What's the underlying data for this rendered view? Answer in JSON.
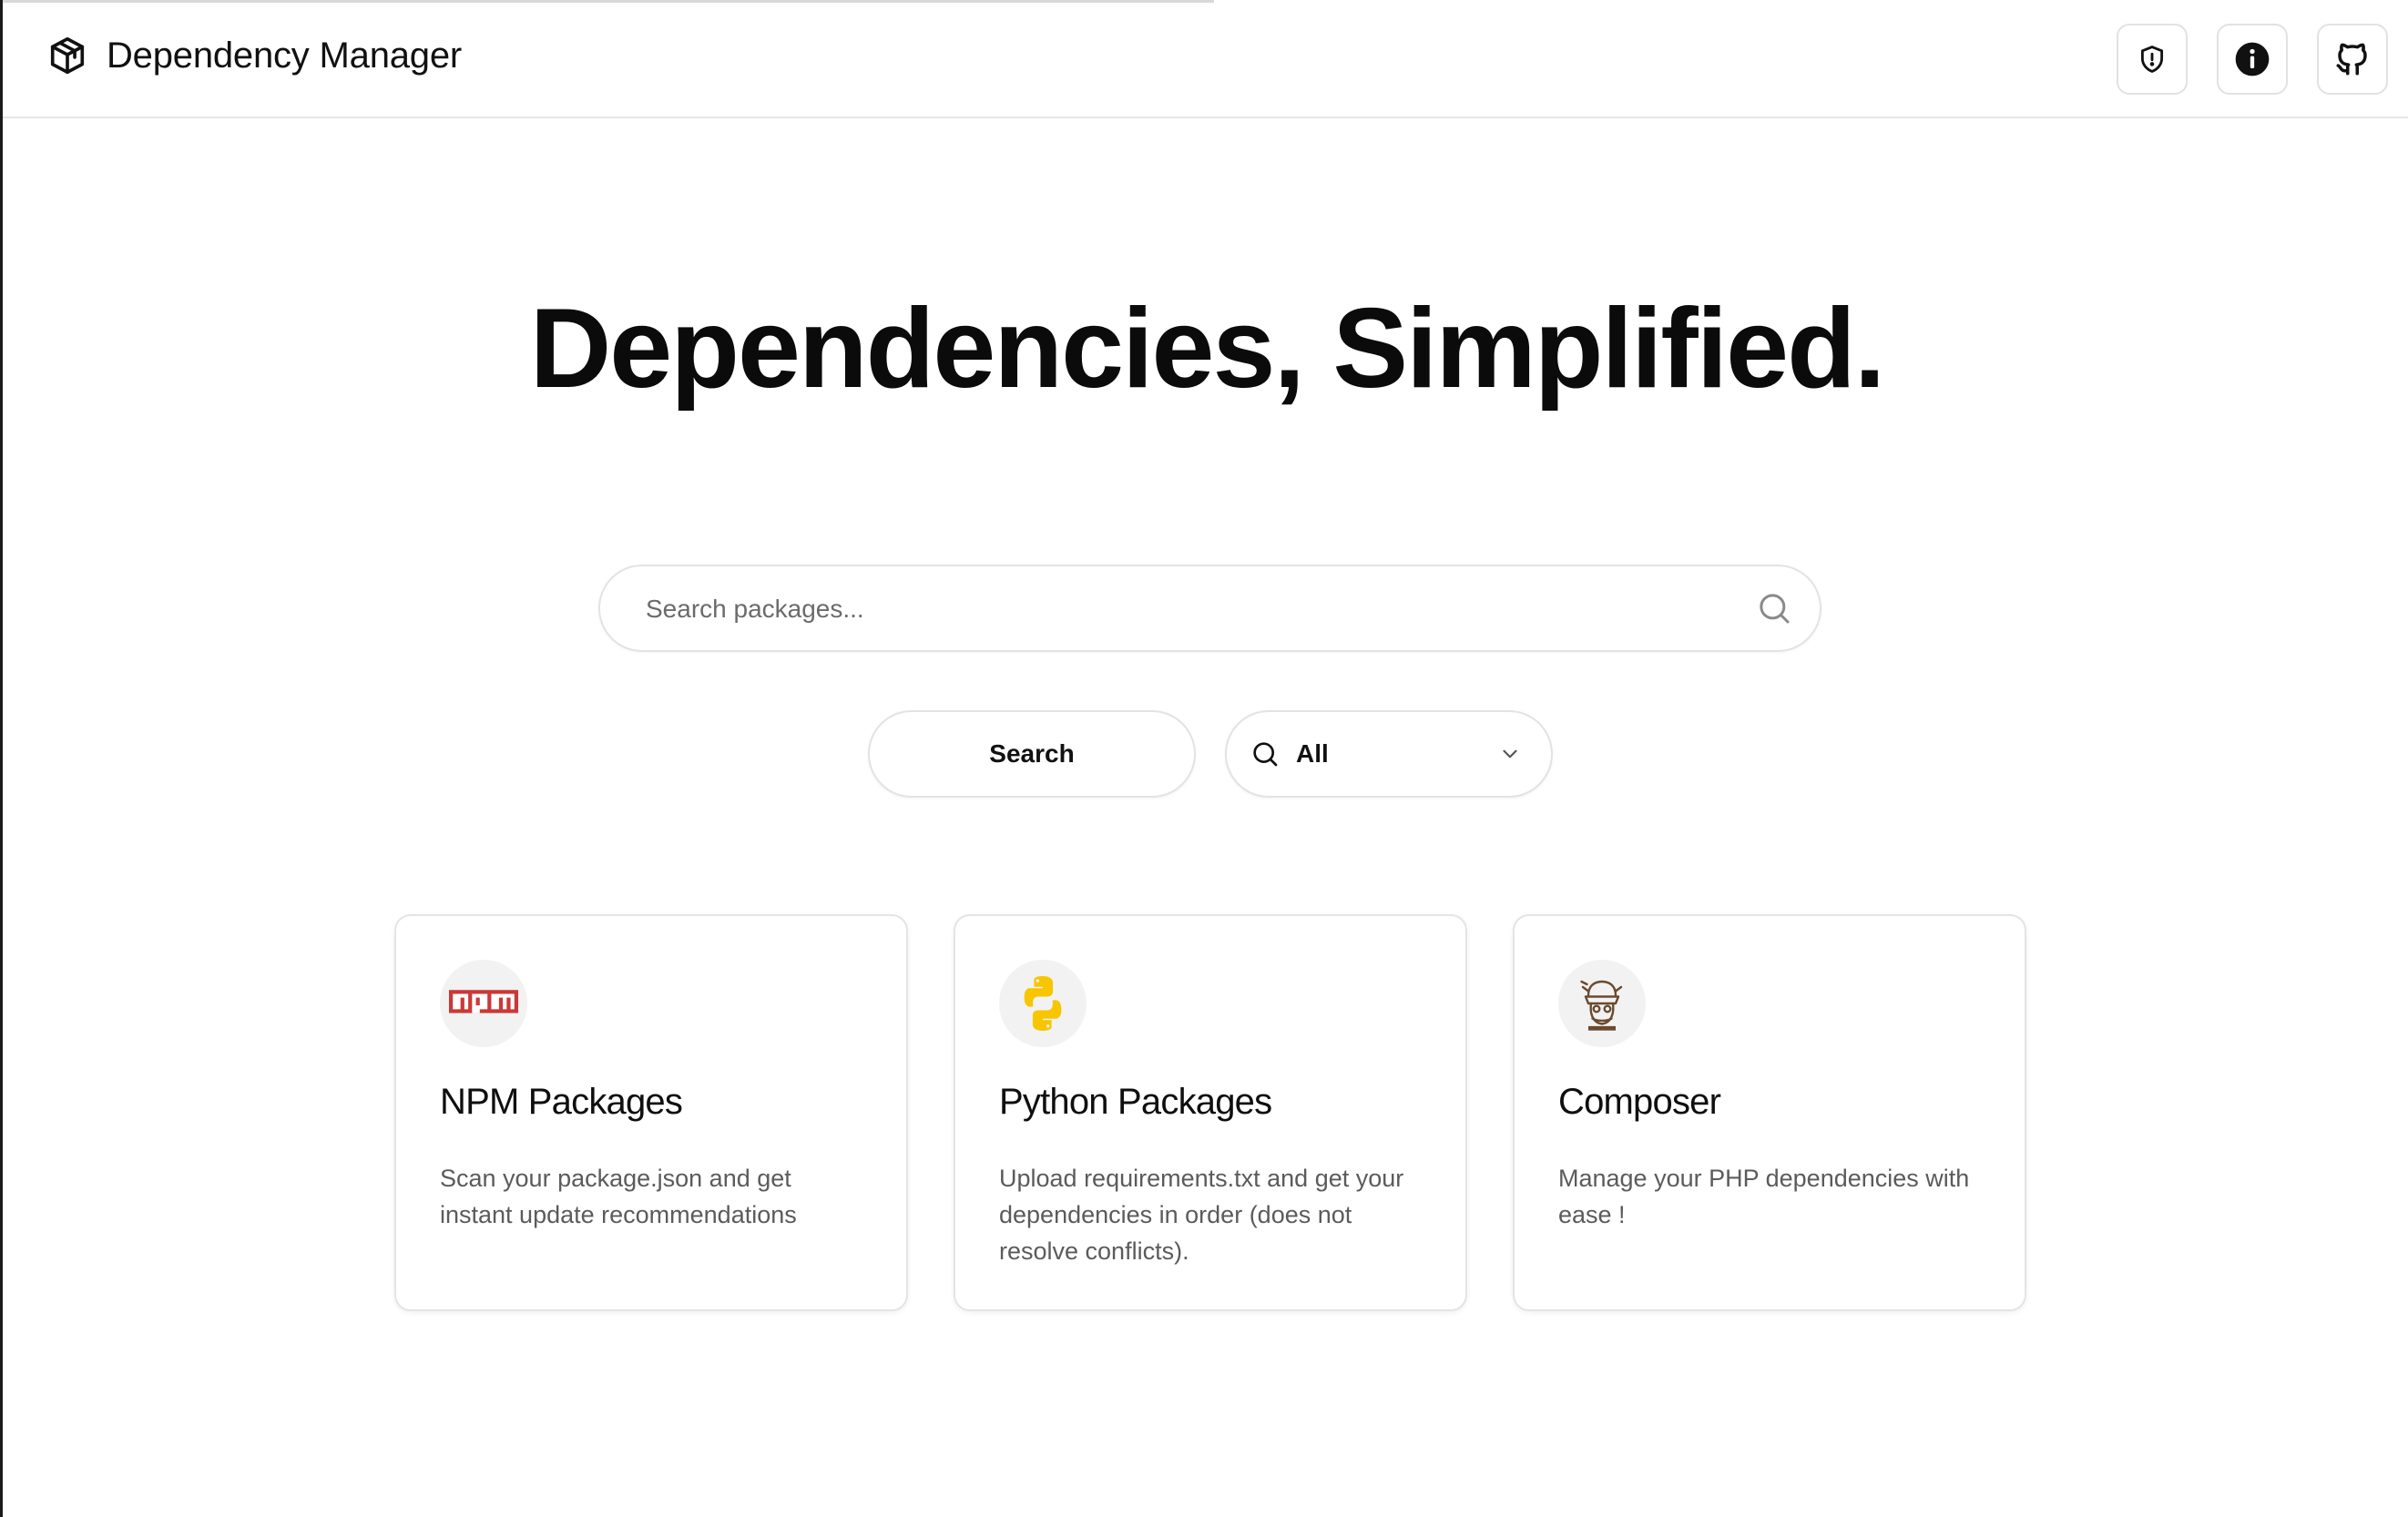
{
  "header": {
    "app_title": "Dependency Manager",
    "actions": [
      {
        "name": "security",
        "icon": "shield-alert-icon"
      },
      {
        "name": "info",
        "icon": "info-icon"
      },
      {
        "name": "github",
        "icon": "github-icon"
      }
    ]
  },
  "hero": {
    "title": "Dependencies, Simplified."
  },
  "search": {
    "placeholder": "Search packages...",
    "value": "",
    "button_label": "Search",
    "filter_selected": "All"
  },
  "cards": [
    {
      "title": "NPM Packages",
      "description": "Scan your package.json and get instant update recommendations",
      "logo": "npm-logo"
    },
    {
      "title": "Python Packages",
      "description": "Upload requirements.txt and get your dependencies in order (does not resolve conflicts).",
      "logo": "python-logo"
    },
    {
      "title": "Composer",
      "description": "Manage your PHP dependencies with ease !",
      "logo": "composer-logo"
    }
  ],
  "colors": {
    "npm_red": "#cb3837",
    "python_yellow": "#f7c600",
    "composer_brown": "#6b4a2f",
    "text_primary": "#111111",
    "text_secondary": "#5b5b5b",
    "border": "#e3e3e3"
  }
}
